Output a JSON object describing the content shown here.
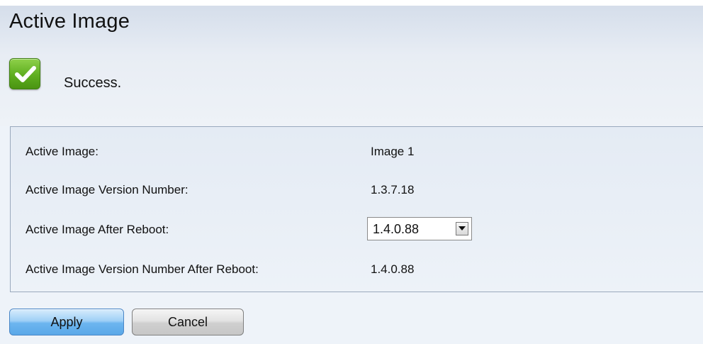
{
  "page": {
    "title": "Active Image"
  },
  "status": {
    "icon": "check-icon",
    "color": "#5fae1f",
    "text": "Success."
  },
  "fields": {
    "active_image": {
      "label": "Active Image:",
      "value": "Image 1"
    },
    "active_image_version": {
      "label": "Active Image Version Number:",
      "value": "1.3.7.18"
    },
    "active_image_after_reboot": {
      "label": "Active Image After Reboot:",
      "selected": "1.4.0.88"
    },
    "version_after_reboot": {
      "label": "Active Image Version Number After Reboot:",
      "value": "1.4.0.88"
    }
  },
  "buttons": {
    "apply_label": "Apply",
    "cancel_label": "Cancel",
    "apply_color": "#6cb5ef"
  }
}
